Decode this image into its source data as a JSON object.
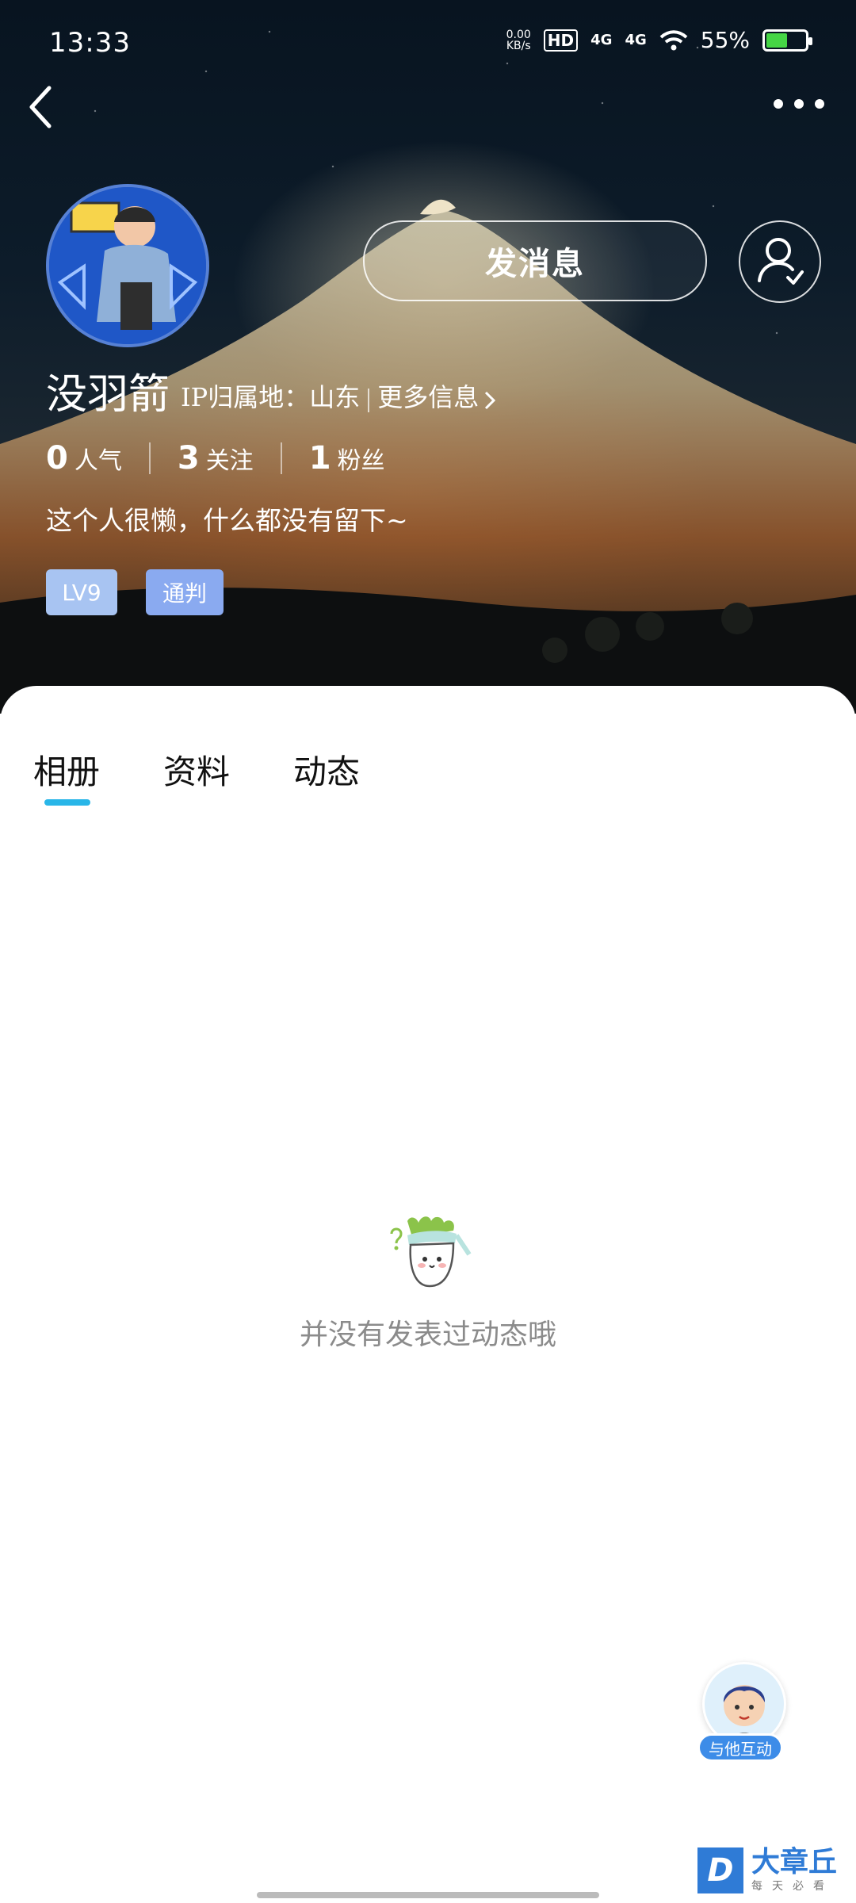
{
  "status_bar": {
    "time": "13:33",
    "net_speed_value": "0.00",
    "net_speed_unit": "KB/s",
    "hd": "HD",
    "signal1": "4G",
    "signal2": "4G",
    "battery": "55%",
    "battery_level": 0.55
  },
  "profile": {
    "username": "没羽箭",
    "ip_location": "IP归属地：山东",
    "more_info": "更多信息",
    "message_button": "发消息",
    "bio": "这个人很懒，什么都没有留下~"
  },
  "stats": [
    {
      "value": "0",
      "label": "人气"
    },
    {
      "value": "3",
      "label": "关注"
    },
    {
      "value": "1",
      "label": "粉丝"
    }
  ],
  "badges": {
    "level": "LV9",
    "role": "通判"
  },
  "tabs": [
    {
      "label": "相册",
      "active": true
    },
    {
      "label": "资料",
      "active": false
    },
    {
      "label": "动态",
      "active": false
    }
  ],
  "empty_state": {
    "text": "并没有发表过动态哦"
  },
  "interact_button": {
    "label": "与他互动"
  },
  "watermark": {
    "letter": "D",
    "title": "大章丘",
    "subtitle": "每天必看"
  },
  "colors": {
    "accent": "#29b6e8",
    "level_badge": "#a8c4f2",
    "role_badge": "#8aaaf0",
    "interact": "#3d8ce8"
  }
}
